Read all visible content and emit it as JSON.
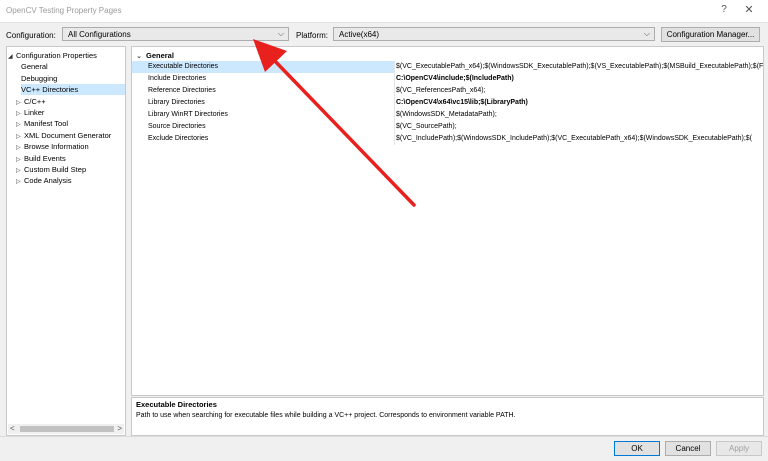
{
  "window": {
    "title": "OpenCV Testing Property Pages",
    "help_glyph": "?",
    "close_glyph": "✕"
  },
  "toolbar": {
    "configuration_label": "Configuration:",
    "configuration_value": "All Configurations",
    "platform_label": "Platform:",
    "platform_value": "Active(x64)",
    "config_manager_label": "Configuration Manager..."
  },
  "tree": {
    "items": [
      {
        "label": "Configuration Properties",
        "twisty": "◢"
      },
      {
        "label": "General"
      },
      {
        "label": "Debugging"
      },
      {
        "label": "VC++ Directories",
        "selected": true
      },
      {
        "label": "C/C++",
        "twisty": "▷"
      },
      {
        "label": "Linker",
        "twisty": "▷"
      },
      {
        "label": "Manifest Tool",
        "twisty": "▷"
      },
      {
        "label": "XML Document Generator",
        "twisty": "▷"
      },
      {
        "label": "Browse Information",
        "twisty": "▷"
      },
      {
        "label": "Build Events",
        "twisty": "▷"
      },
      {
        "label": "Custom Build Step",
        "twisty": "▷"
      },
      {
        "label": "Code Analysis",
        "twisty": "▷"
      }
    ],
    "scroll_left": "<",
    "scroll_right": ">"
  },
  "grid": {
    "category": "General",
    "chevron": "⌄",
    "rows": [
      {
        "name": "Executable Directories",
        "value": "$(VC_ExecutablePath_x64);$(WindowsSDK_ExecutablePath);$(VS_ExecutablePath);$(MSBuild_ExecutablePath);$(F",
        "bold": false,
        "selected": true
      },
      {
        "name": "Include Directories",
        "value": "C:\\OpenCV4\\include;$(IncludePath)",
        "bold": true
      },
      {
        "name": "Reference Directories",
        "value": "$(VC_ReferencesPath_x64);",
        "bold": false
      },
      {
        "name": "Library Directories",
        "value": "C:\\OpenCV4\\x64\\vc15\\lib;$(LibraryPath)",
        "bold": true
      },
      {
        "name": "Library WinRT Directories",
        "value": "$(WindowsSDK_MetadataPath);",
        "bold": false
      },
      {
        "name": "Source Directories",
        "value": "$(VC_SourcePath);",
        "bold": false
      },
      {
        "name": "Exclude Directories",
        "value": "$(VC_IncludePath);$(WindowsSDK_IncludePath);$(VC_ExecutablePath_x64);$(WindowsSDK_ExecutablePath);$(",
        "bold": false
      }
    ]
  },
  "description": {
    "title": "Executable Directories",
    "text": "Path to use when searching for executable files while building a VC++ project.  Corresponds to environment variable PATH."
  },
  "buttons": {
    "ok": "OK",
    "cancel": "Cancel",
    "apply": "Apply"
  },
  "colors": {
    "annotation_arrow": "#e8201e",
    "selection": "#cce8ff",
    "accent": "#0078d7"
  }
}
